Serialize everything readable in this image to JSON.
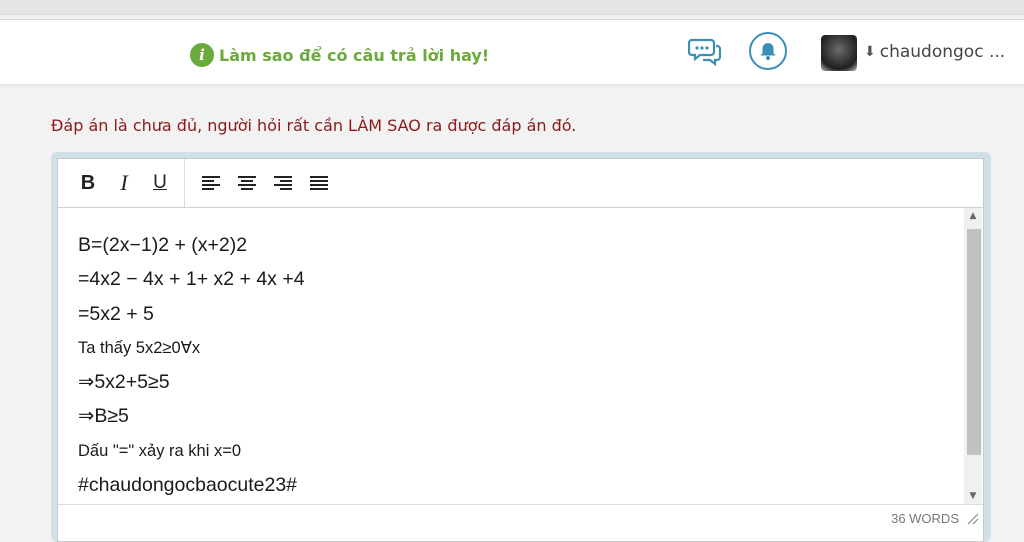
{
  "header": {
    "tip_text": "Làm sao để có câu trả lời hay!",
    "username": "chaudongoc ..."
  },
  "notice": "Đáp án là chưa đủ, người hỏi rất cần LÀM SAO ra được đáp án đó.",
  "toolbar": {
    "bold_label": "B",
    "italic_label": "I",
    "underline_label": "U"
  },
  "content": {
    "lines": [
      "B=(2x−1)2 + (x+2)2",
      "=4x2 − 4x + 1+ x2 + 4x +4",
      "=5x2 + 5",
      "Ta thấy 5x2≥0∀x",
      "⇒5x2+5≥5",
      "⇒B≥5",
      "Dấu \"=\" xảy ra khi x=0",
      "#chaudongocbaocute23#"
    ]
  },
  "status": {
    "word_count": "36 WORDS"
  },
  "colors": {
    "tip_green": "#6aaa3b",
    "accent_blue": "#3a8fb7",
    "notice_red": "#8b1a1a",
    "editor_frame": "#cfe0e7"
  },
  "icons": {
    "tip": "info-icon",
    "chat": "chat-bubbles-icon",
    "bell": "bell-icon",
    "user_chevron": "double-chevron-down-icon"
  }
}
